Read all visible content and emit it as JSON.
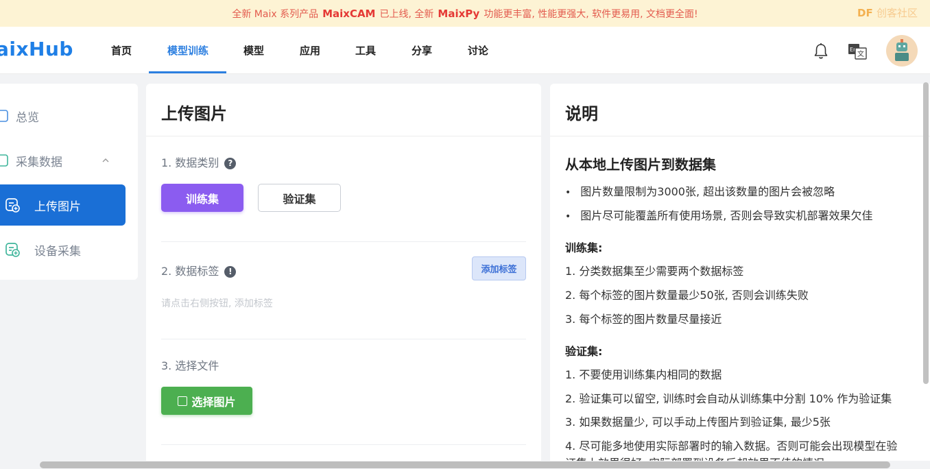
{
  "banner": {
    "part1": "全新 Maix 系列产品",
    "product1": "MaixCAM",
    "part2": "已上线, 全新",
    "product2": "MaixPy",
    "part3": "功能更丰富, 性能更强大, 软件更易用, 文档更全面!",
    "corner_logo": "DF",
    "corner_text": "创客社区"
  },
  "header": {
    "logo": "aixHub",
    "nav": [
      {
        "label": "首页"
      },
      {
        "label": "模型训练"
      },
      {
        "label": "模型"
      },
      {
        "label": "应用"
      },
      {
        "label": "工具"
      },
      {
        "label": "分享"
      },
      {
        "label": "讨论"
      }
    ],
    "active_index": 1,
    "icons": [
      "bell-icon",
      "translate-icon",
      "avatar"
    ]
  },
  "sidebar": {
    "items": [
      {
        "label": "总览",
        "icon": "overview-icon"
      },
      {
        "label": "采集数据",
        "icon": "collect-icon",
        "expanded": true
      },
      {
        "label": "上传图片",
        "icon": "upload-image-icon",
        "active": true
      },
      {
        "label": "设备采集",
        "icon": "device-collect-icon"
      }
    ]
  },
  "upload": {
    "title": "上传图片",
    "step1": "1. 数据类别",
    "train_label": "训练集",
    "val_label": "验证集",
    "step2": "2. 数据标签",
    "add_tag_label": "添加标签",
    "tag_hint": "请点击右侧按钮, 添加标签",
    "step3": "3. 选择文件",
    "select_label": "选择图片"
  },
  "description": {
    "title": "说明",
    "heading": "从本地上传图片到数据集",
    "bullets": [
      "图片数量限制为3000张, 超出该数量的图片会被忽略",
      "图片尽可能覆盖所有使用场景, 否则会导致实机部署效果欠佳"
    ],
    "train_title": "训练集:",
    "train_rules": [
      "1. 分类数据集至少需要两个数据标签",
      "2. 每个标签的图片数量最少50张, 否则会训练失败",
      "3. 每个标签的图片数量尽量接近"
    ],
    "val_title": "验证集:",
    "val_rules": [
      "1. 不要使用训练集内相同的数据",
      "2. 验证集可以留空, 训练时会自动从训练集中分割 10% 作为验证集",
      "3. 如果数据量少, 可以手动上传图片到验证集, 最少5张",
      "4. 尽可能多地使用实际部署时的输入数据。否则可能会出现模型在验",
      "证集上效果很好, 实际部署到设备后却效果不佳的情况"
    ]
  },
  "colors": {
    "accent": "#2c7fe0",
    "train_button": "#8b5cf0",
    "select_button": "#4caf50",
    "sidebar_active": "#1a6fd6",
    "banner_bg": "#fdf3d4"
  }
}
